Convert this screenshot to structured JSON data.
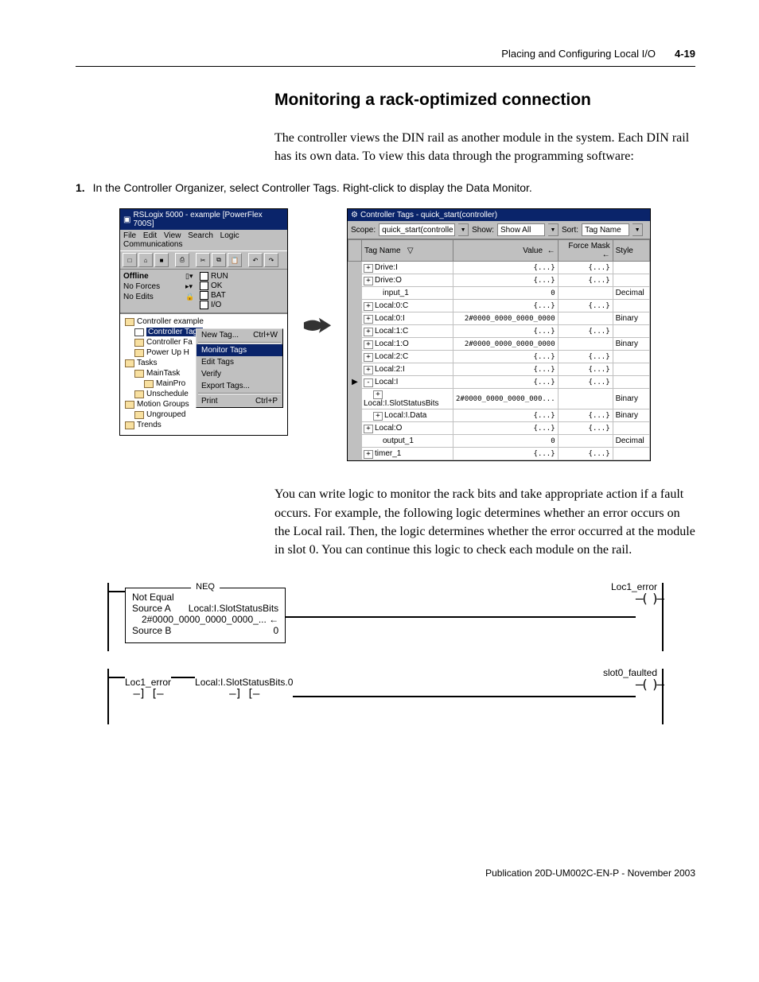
{
  "header": {
    "chapter": "Placing and Configuring Local I/O",
    "page": "4-19"
  },
  "section_title": "Monitoring a rack-optimized connection",
  "para1": "The controller views the DIN rail as another module in the system. Each DIN rail has its own data. To view this data through the programming software:",
  "step1_num": "1.",
  "step1_text": "In the Controller Organizer, select Controller Tags. Right-click to display the Data Monitor.",
  "para2": "You can write logic to monitor the rack bits and take appropriate action if a fault occurs. For example, the following logic determines whether an error occurs on the Local rail. Then, the logic determines whether the error occurred at the module in slot 0. You can continue this logic to check each module on the rail.",
  "footer": "Publication 20D-UM002C-EN-P - November 2003",
  "left_win": {
    "title": "RSLogix 5000 - example [PowerFlex 700S]",
    "menus": {
      "file": "File",
      "edit": "Edit",
      "view": "View",
      "search": "Search",
      "logic": "Logic",
      "comm": "Communications"
    },
    "status": {
      "offline": "Offline",
      "noforces": "No Forces",
      "noedits": "No Edits",
      "run": "RUN",
      "ok": "OK",
      "bat": "BAT",
      "io": "I/O"
    },
    "tree": {
      "t0": "Controller example",
      "t1": "Controller Tags",
      "t2": "Controller Fa",
      "t3": "Power Up H",
      "t4": "Tasks",
      "t5": "MainTask",
      "t6": "MainPro",
      "t7": "Unschedule",
      "t8": "Motion Groups",
      "t9": "Ungrouped",
      "t10": "Trends"
    },
    "ctx": {
      "m0": "New Tag...",
      "m0s": "Ctrl+W",
      "m1": "Monitor Tags",
      "m2": "Edit Tags",
      "m3": "Verify",
      "m4": "Export Tags...",
      "m5": "Print",
      "m5s": "Ctrl+P"
    }
  },
  "right_win": {
    "title": "Controller Tags - quick_start(controller)",
    "scope_lbl": "Scope:",
    "scope_val": "quick_start(controlle",
    "show_lbl": "Show:",
    "show_val": "Show All",
    "sort_lbl": "Sort:",
    "sort_val": "Tag Name",
    "cols": {
      "name": "Tag Name",
      "value": "Value",
      "force": "Force Mask",
      "style": "Style"
    },
    "rows": [
      {
        "n": "Drive:I",
        "v": "{...}",
        "f": "{...}",
        "s": "",
        "e": "+",
        "i": 0
      },
      {
        "n": "Drive:O",
        "v": "{...}",
        "f": "{...}",
        "s": "",
        "e": "+",
        "i": 0
      },
      {
        "n": "input_1",
        "v": "0",
        "f": "",
        "s": "Decimal",
        "e": "",
        "i": 1
      },
      {
        "n": "Local:0:C",
        "v": "{...}",
        "f": "{...}",
        "s": "",
        "e": "+",
        "i": 0
      },
      {
        "n": "Local:0:I",
        "v": "2#0000_0000_0000_0000",
        "f": "",
        "s": "Binary",
        "e": "+",
        "i": 0
      },
      {
        "n": "Local:1:C",
        "v": "{...}",
        "f": "{...}",
        "s": "",
        "e": "+",
        "i": 0
      },
      {
        "n": "Local:1:O",
        "v": "2#0000_0000_0000_0000",
        "f": "",
        "s": "Binary",
        "e": "+",
        "i": 0
      },
      {
        "n": "Local:2:C",
        "v": "{...}",
        "f": "{...}",
        "s": "",
        "e": "+",
        "i": 0
      },
      {
        "n": "Local:2:I",
        "v": "{...}",
        "f": "{...}",
        "s": "",
        "e": "+",
        "i": 0
      },
      {
        "n": "Local:I",
        "v": "{...}",
        "f": "{...}",
        "s": "",
        "e": "-",
        "i": 0,
        "ptr": true
      },
      {
        "n": "Local:I.SlotStatusBits",
        "v": "2#0000_0000_0000_000...",
        "f": "",
        "s": "Binary",
        "e": "+",
        "i": 1
      },
      {
        "n": "Local:I.Data",
        "v": "{...}",
        "f": "{...}",
        "s": "Binary",
        "e": "+",
        "i": 1
      },
      {
        "n": "Local:O",
        "v": "{...}",
        "f": "{...}",
        "s": "",
        "e": "+",
        "i": 0
      },
      {
        "n": "output_1",
        "v": "0",
        "f": "",
        "s": "Decimal",
        "e": "",
        "i": 1
      },
      {
        "n": "timer_1",
        "v": "{...}",
        "f": "{...}",
        "s": "",
        "e": "+",
        "i": 0
      }
    ]
  },
  "ladder": {
    "neq_title": "NEQ",
    "neq_name": "Not Equal",
    "neq_a_lbl": "Source A",
    "neq_a_val": "Local:I.SlotStatusBits",
    "neq_a_under": "2#0000_0000_0000_0000_...",
    "neq_b_lbl": "Source B",
    "neq_b_val": "0",
    "out1": "Loc1_error",
    "c1": "Loc1_error",
    "c2": "Local:I.SlotStatusBits.0",
    "out2": "slot0_faulted"
  }
}
